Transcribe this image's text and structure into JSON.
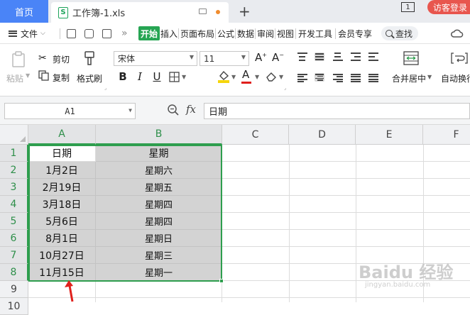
{
  "titlebar": {
    "home_tab": "首页",
    "doc_tab": "工作簿-1.xls",
    "doc_icon_letter": "S",
    "new_tab": "+",
    "window_count": "1",
    "visitor_login": "访客登录"
  },
  "menu": {
    "file": "文件",
    "items": [
      "开始",
      "插入",
      "页面布局",
      "公式",
      "数据",
      "审阅",
      "视图",
      "开发工具",
      "会员专享"
    ],
    "more": "»",
    "search": "查找"
  },
  "ribbon": {
    "paste": "粘贴",
    "cut": "剪切",
    "copy": "复制",
    "format_painter": "格式刷",
    "font_name": "宋体",
    "font_size": "11",
    "grow_font": "A",
    "shrink_font": "A",
    "bold": "B",
    "italic": "I",
    "underline": "U",
    "font_color_letter": "A",
    "merge_center": "合并居中",
    "auto_wrap": "自动换行"
  },
  "formula_bar": {
    "name_box": "A1",
    "fx": "fx",
    "content": "日期"
  },
  "sheet": {
    "columns": [
      "A",
      "B",
      "C",
      "D",
      "E",
      "F"
    ],
    "rows": [
      "1",
      "2",
      "3",
      "4",
      "5",
      "6",
      "7",
      "8",
      "9",
      "10"
    ],
    "cells_a": [
      "日期",
      "1月2日",
      "2月19日",
      "3月18日",
      "5月6日",
      "8月1日",
      "10月27日",
      "11月15日"
    ],
    "cells_b": [
      "星期",
      "星期六",
      "星期五",
      "星期四",
      "星期四",
      "星期日",
      "星期三",
      "星期一"
    ]
  },
  "watermark": {
    "text": "Baidu 经验",
    "url": "jingyan.baidu.com"
  },
  "colors": {
    "accent_green": "#2e9e4e",
    "home_tab_blue": "#4a84f7",
    "visitor_red": "#e8564e",
    "arrow_red": "#e0201c"
  }
}
